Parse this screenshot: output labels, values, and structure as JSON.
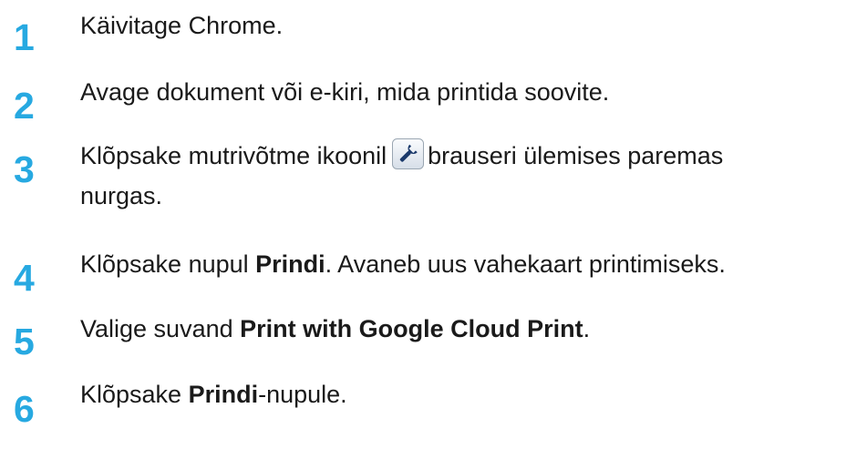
{
  "steps": [
    {
      "number": "1",
      "text": "Käivitage Chrome."
    },
    {
      "number": "2",
      "text": "Avage dokument või e-kiri, mida printida soovite."
    },
    {
      "number": "3",
      "text_before_icon": "Klõpsake mutrivõtme ikoonil",
      "icon": "wrench-icon",
      "text_after_icon": "brauseri ülemises paremas",
      "text_line2": "nurgas."
    },
    {
      "number": "4",
      "text_prefix": "Klõpsake nupul ",
      "text_bold": "Prindi",
      "text_suffix": ". Avaneb uus vahekaart printimiseks."
    },
    {
      "number": "5",
      "text_prefix": "Valige suvand ",
      "text_bold": "Print with Google Cloud Print",
      "text_suffix": "."
    },
    {
      "number": "6",
      "text_prefix": "Klõpsake ",
      "text_bold": "Prindi",
      "text_suffix": "-nupule."
    }
  ],
  "colors": {
    "step_number": "#27a9e1",
    "text": "#1a1a1a",
    "icon_bg": "#e8eef5",
    "icon_border": "#9aa6b2",
    "icon_glyph": "#1b3a6b"
  }
}
